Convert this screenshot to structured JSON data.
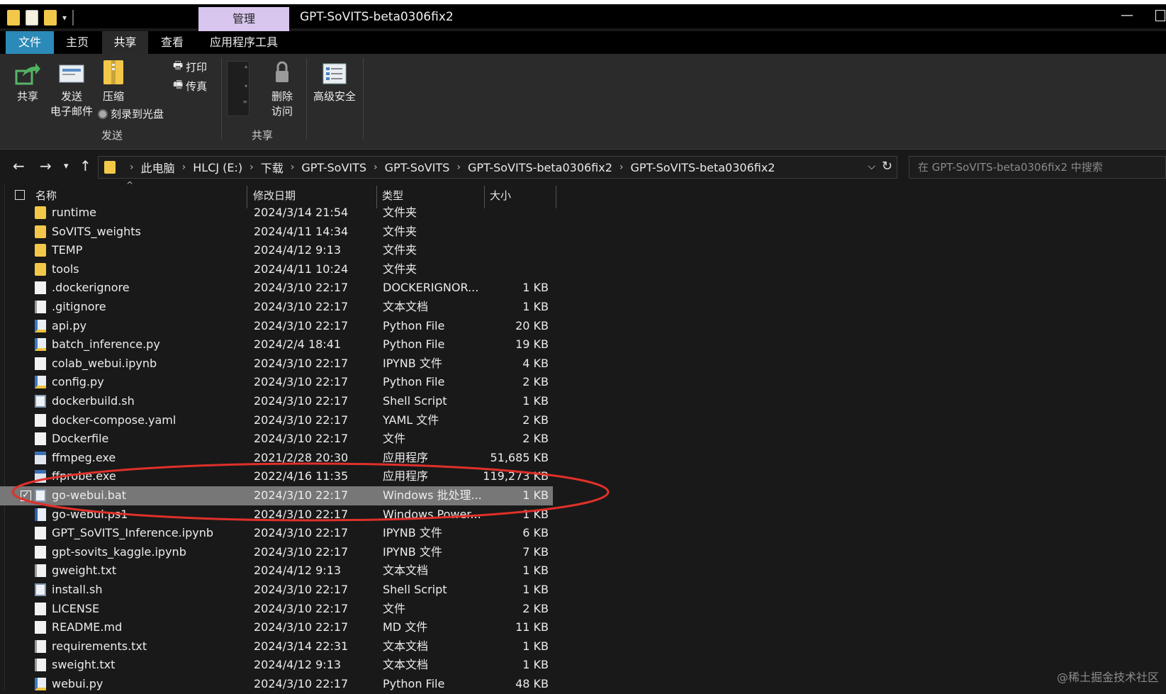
{
  "window": {
    "title": "GPT-SoVITS-beta0306fix2",
    "manage_tab": "管理"
  },
  "ribbon_tabs": [
    "文件",
    "主页",
    "共享",
    "查看",
    "应用程序工具"
  ],
  "ribbon": {
    "share_label": "共享",
    "email_label_line1": "发送",
    "email_label_line2": "电子邮件",
    "zip_label": "压缩",
    "print_label": "打印",
    "fax_label": "传真",
    "burn_label": "刻录到光盘",
    "group_send": "发送",
    "remove_access_line1": "删除",
    "remove_access_line2": "访问",
    "group_share": "共享",
    "advanced_security": "高级安全"
  },
  "breadcrumb": [
    "此电脑",
    "HLCJ (E:)",
    "下载",
    "GPT-SoVITS",
    "GPT-SoVITS",
    "GPT-SoVITS-beta0306fix2",
    "GPT-SoVITS-beta0306fix2"
  ],
  "search": {
    "placeholder": "在 GPT-SoVITS-beta0306fix2 中搜索"
  },
  "columns": {
    "name": "名称",
    "date": "修改日期",
    "type": "类型",
    "size": "大小"
  },
  "files": [
    {
      "name": "runtime",
      "date": "2024/3/14 21:54",
      "type": "文件夹",
      "size": "",
      "icon": "folder"
    },
    {
      "name": "SoVITS_weights",
      "date": "2024/4/11 14:34",
      "type": "文件夹",
      "size": "",
      "icon": "folder"
    },
    {
      "name": "TEMP",
      "date": "2024/4/12 9:13",
      "type": "文件夹",
      "size": "",
      "icon": "folder"
    },
    {
      "name": "tools",
      "date": "2024/4/11 10:24",
      "type": "文件夹",
      "size": "",
      "icon": "folder"
    },
    {
      "name": ".dockerignore",
      "date": "2024/3/10 22:17",
      "type": "DOCKERIGNOR...",
      "size": "1 KB",
      "icon": "doc"
    },
    {
      "name": ".gitignore",
      "date": "2024/3/10 22:17",
      "type": "文本文档",
      "size": "1 KB",
      "icon": "txt"
    },
    {
      "name": "api.py",
      "date": "2024/3/10 22:17",
      "type": "Python File",
      "size": "20 KB",
      "icon": "py"
    },
    {
      "name": "batch_inference.py",
      "date": "2024/2/4 18:41",
      "type": "Python File",
      "size": "19 KB",
      "icon": "py"
    },
    {
      "name": "colab_webui.ipynb",
      "date": "2024/3/10 22:17",
      "type": "IPYNB 文件",
      "size": "4 KB",
      "icon": "doc"
    },
    {
      "name": "config.py",
      "date": "2024/3/10 22:17",
      "type": "Python File",
      "size": "2 KB",
      "icon": "py"
    },
    {
      "name": "dockerbuild.sh",
      "date": "2024/3/10 22:17",
      "type": "Shell Script",
      "size": "1 KB",
      "icon": "sh"
    },
    {
      "name": "docker-compose.yaml",
      "date": "2024/3/10 22:17",
      "type": "YAML 文件",
      "size": "2 KB",
      "icon": "doc"
    },
    {
      "name": "Dockerfile",
      "date": "2024/3/10 22:17",
      "type": "文件",
      "size": "2 KB",
      "icon": "doc"
    },
    {
      "name": "ffmpeg.exe",
      "date": "2021/2/28 20:30",
      "type": "应用程序",
      "size": "51,685 KB",
      "icon": "exe"
    },
    {
      "name": "ffprobe.exe",
      "date": "2022/4/16 11:35",
      "type": "应用程序",
      "size": "119,273 KB",
      "icon": "exe"
    },
    {
      "name": "go-webui.bat",
      "date": "2024/3/10 22:17",
      "type": "Windows 批处理...",
      "size": "1 KB",
      "icon": "sh",
      "selected": true
    },
    {
      "name": "go-webui.ps1",
      "date": "2024/3/10 22:17",
      "type": "Windows Power...",
      "size": "1 KB",
      "icon": "ps"
    },
    {
      "name": "GPT_SoVITS_Inference.ipynb",
      "date": "2024/3/10 22:17",
      "type": "IPYNB 文件",
      "size": "6 KB",
      "icon": "doc"
    },
    {
      "name": "gpt-sovits_kaggle.ipynb",
      "date": "2024/3/10 22:17",
      "type": "IPYNB 文件",
      "size": "7 KB",
      "icon": "doc"
    },
    {
      "name": "gweight.txt",
      "date": "2024/4/12 9:13",
      "type": "文本文档",
      "size": "1 KB",
      "icon": "txt"
    },
    {
      "name": "install.sh",
      "date": "2024/3/10 22:17",
      "type": "Shell Script",
      "size": "1 KB",
      "icon": "sh"
    },
    {
      "name": "LICENSE",
      "date": "2024/3/10 22:17",
      "type": "文件",
      "size": "2 KB",
      "icon": "doc"
    },
    {
      "name": "README.md",
      "date": "2024/3/10 22:17",
      "type": "MD 文件",
      "size": "11 KB",
      "icon": "doc"
    },
    {
      "name": "requirements.txt",
      "date": "2024/3/14 22:31",
      "type": "文本文档",
      "size": "1 KB",
      "icon": "txt"
    },
    {
      "name": "sweight.txt",
      "date": "2024/4/12 9:13",
      "type": "文本文档",
      "size": "1 KB",
      "icon": "txt"
    },
    {
      "name": "webui.py",
      "date": "2024/3/10 22:17",
      "type": "Python File",
      "size": "48 KB",
      "icon": "py"
    }
  ],
  "watermark": "@稀土掘金技术社区",
  "colors": {
    "accent": "#2b8ab8",
    "selection": "#777777",
    "annotation": "#e0302a"
  }
}
